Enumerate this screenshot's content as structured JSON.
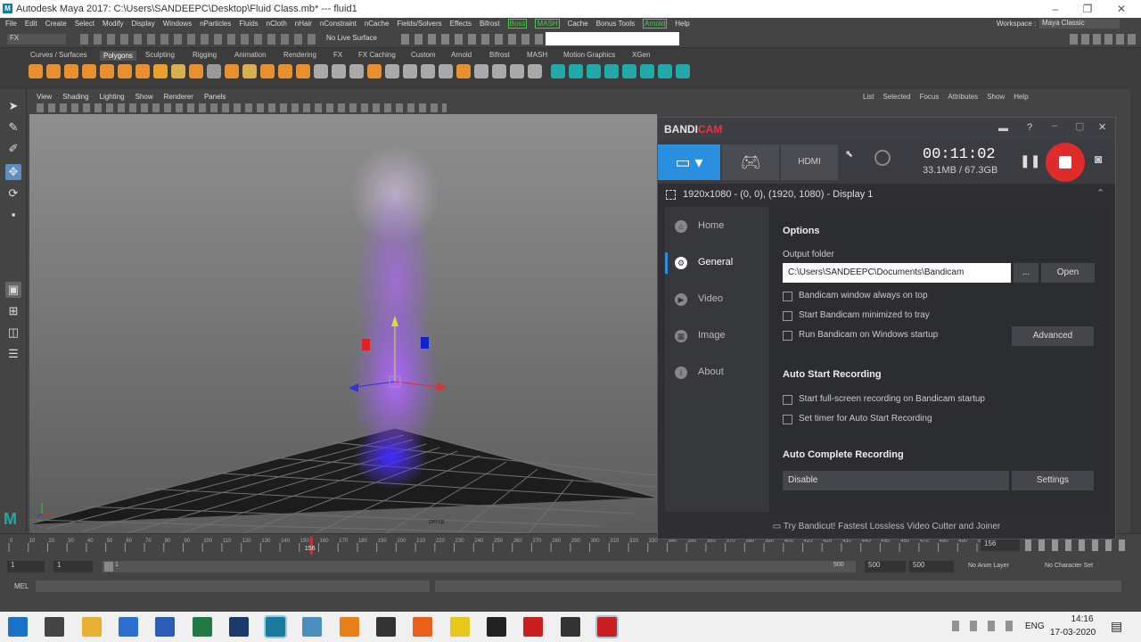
{
  "window": {
    "title": "Autodesk Maya 2017: C:\\Users\\SANDEEPC\\Desktop\\Fluid Class.mb*   ---   fluid1",
    "workspace_label": "Workspace :",
    "workspace_value": "Maya Classic"
  },
  "menubar": [
    "File",
    "Edit",
    "Create",
    "Select",
    "Modify",
    "Display",
    "Windows",
    "nParticles",
    "Fluids",
    "nCloth",
    "nHair",
    "nConstraint",
    "nCache",
    "Fields/Solvers",
    "Effects",
    "Bifrost",
    "Boss",
    "MASH",
    "Cache",
    "Bonus Tools",
    "Arnold",
    "Help"
  ],
  "statusline": {
    "mode": "FX",
    "live_surface": "No Live Surface"
  },
  "shelf_tabs": [
    "Curves / Surfaces",
    "Polygons",
    "Sculpting",
    "Rigging",
    "Animation",
    "Rendering",
    "FX",
    "FX Caching",
    "Custom",
    "Arnold",
    "Bifrost",
    "MASH",
    "Motion Graphics",
    "XGen"
  ],
  "shelf_active": "Polygons",
  "viewport": {
    "menu": [
      "View",
      "Shading",
      "Lighting",
      "Show",
      "Renderer",
      "Panels"
    ],
    "camera_label": "persp"
  },
  "right_panel": {
    "menu": [
      "List",
      "Selected",
      "Focus",
      "Attributes",
      "Show",
      "Help"
    ]
  },
  "timeline": {
    "ticks": [
      "0",
      "10",
      "20",
      "30",
      "40",
      "50",
      "60",
      "70",
      "80",
      "90",
      "100",
      "110",
      "120",
      "130",
      "140",
      "150",
      "160",
      "170",
      "180",
      "190",
      "200",
      "210",
      "220",
      "230",
      "240",
      "250",
      "260",
      "270",
      "280",
      "290",
      "300",
      "310",
      "320",
      "330",
      "340",
      "350",
      "360",
      "370",
      "380",
      "390",
      "400",
      "410",
      "420",
      "430",
      "440",
      "450",
      "460",
      "470",
      "480",
      "490",
      "500"
    ],
    "current_frame": "156",
    "frame_field": "156"
  },
  "range": {
    "start": "1",
    "start2": "1",
    "slider_start": "1",
    "slider_end": "500",
    "end": "500",
    "end2": "500",
    "anim_layer": "No Anim Layer",
    "char_set": "No Character Set"
  },
  "cmdline": {
    "label": "MEL"
  },
  "bandicam": {
    "title_a": "BANDI",
    "title_b": "CAM",
    "timer": "00:11:02",
    "size": "33.1MB / 67.3GB",
    "mode_hdmi": "HDMI",
    "resolution": "1920x1080 - (0, 0), (1920, 1080) - Display 1",
    "nav": [
      "Home",
      "General",
      "Video",
      "Image",
      "About"
    ],
    "nav_active": "General",
    "options_title": "Options",
    "output_folder_label": "Output folder",
    "output_folder_value": "C:\\Users\\SANDEEPC\\Documents\\Bandicam",
    "browse_label": "...",
    "open_label": "Open",
    "checks1": [
      "Bandicam window always on top",
      "Start Bandicam minimized to tray",
      "Run Bandicam on Windows startup"
    ],
    "advanced_label": "Advanced",
    "auto_start_title": "Auto Start Recording",
    "checks2": [
      "Start full-screen recording on Bandicam startup",
      "Set timer for Auto Start Recording"
    ],
    "auto_complete_title": "Auto Complete Recording",
    "auto_complete_value": "Disable",
    "settings_label": "Settings",
    "footer": "Try Bandicut! Fastest Lossless Video Cutter and Joiner",
    "accent": "#2b8fe0",
    "rec_color": "#e02b2b"
  },
  "taskbar": {
    "lang": "ENG",
    "time": "14:16",
    "date": "17-03-2020"
  }
}
